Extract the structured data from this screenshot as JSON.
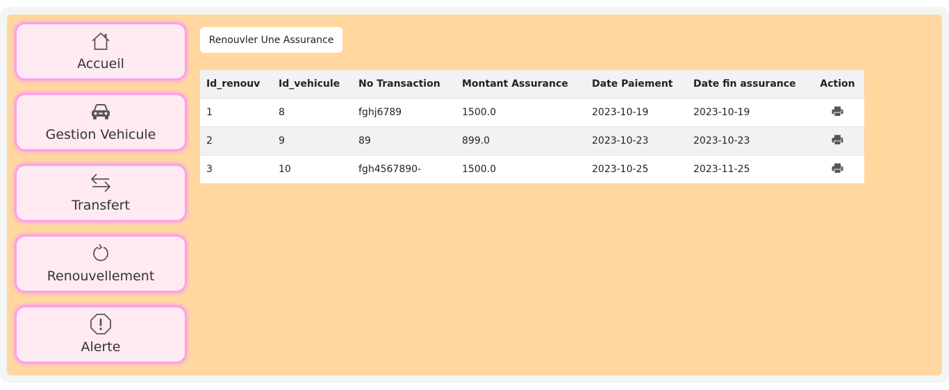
{
  "sidebar": {
    "items": [
      {
        "label": "Accueil",
        "icon": "home-icon"
      },
      {
        "label": "Gestion Vehicule",
        "icon": "car-icon"
      },
      {
        "label": "Transfert",
        "icon": "transfer-icon"
      },
      {
        "label": "Renouvellement",
        "icon": "refresh-icon"
      },
      {
        "label": "Alerte",
        "icon": "alert-icon"
      }
    ]
  },
  "toolbar": {
    "renew_label": "Renouvler Une Assurance"
  },
  "table": {
    "headers": [
      "Id_renouv",
      "Id_vehicule",
      "No Transaction",
      "Montant Assurance",
      "Date Paiement",
      "Date fin assurance",
      "Action"
    ],
    "rows": [
      {
        "id_renouv": "1",
        "id_vehicule": "8",
        "no_transaction": "fghj6789",
        "montant": "1500.0",
        "date_paiement": "2023-10-19",
        "date_fin": "2023-10-19",
        "action_icon": "print-icon"
      },
      {
        "id_renouv": "2",
        "id_vehicule": "9",
        "no_transaction": "89",
        "montant": "899.0",
        "date_paiement": "2023-10-23",
        "date_fin": "2023-10-23",
        "action_icon": "print-icon"
      },
      {
        "id_renouv": "3",
        "id_vehicule": "10",
        "no_transaction": "fgh4567890-",
        "montant": "1500.0",
        "date_paiement": "2023-10-25",
        "date_fin": "2023-11-25",
        "action_icon": "print-icon"
      }
    ]
  },
  "colors": {
    "panel_bg": "#ffd79f",
    "nav_bg": "#ffeaf2",
    "nav_glow": "#ff9cec"
  }
}
